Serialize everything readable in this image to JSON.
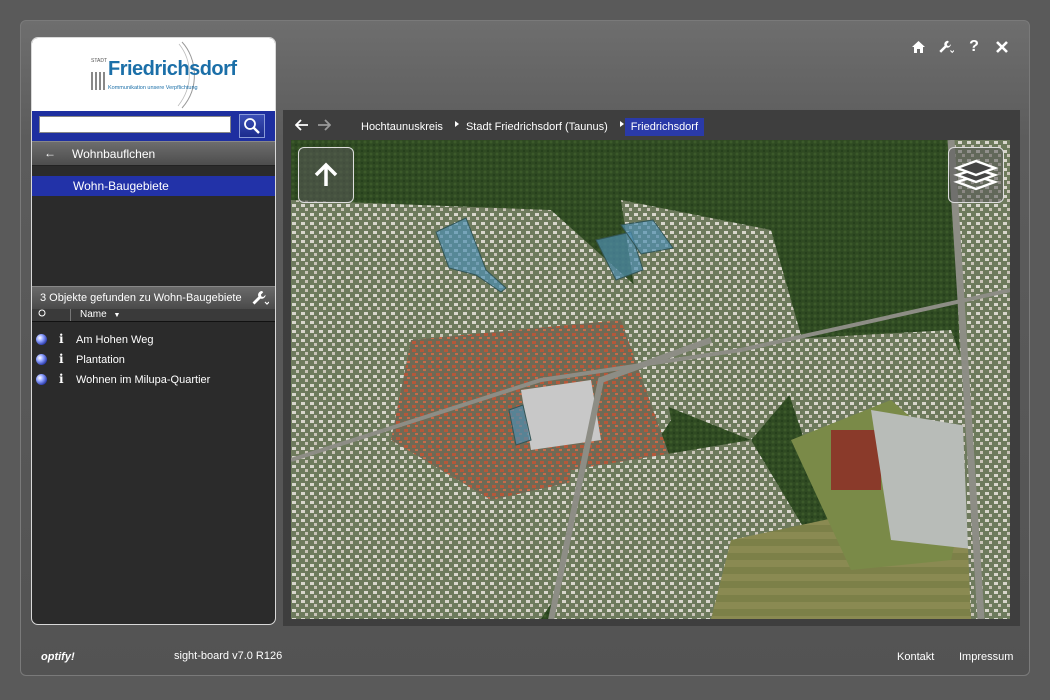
{
  "top_icons": [
    "home-icon",
    "wrench-icon",
    "help-icon",
    "close-icon"
  ],
  "top_icon_labels": {
    "help": "?"
  },
  "logo": {
    "small": "STADT",
    "name": "Friedrichsdorf",
    "tagline": "Kommunikation unsere Verpflichtung"
  },
  "search": {
    "value": "",
    "placeholder": ""
  },
  "category": {
    "back_label": "←",
    "title": "Wohnbauflchen"
  },
  "category_items": [
    {
      "label": "Wohn-Baugebiete"
    }
  ],
  "results_bar": {
    "label": "3 Objekte gefunden zu Wohn-Baugebiete"
  },
  "columns": {
    "name": "Name"
  },
  "results": [
    {
      "info": "i",
      "name": "Am Hohen Weg"
    },
    {
      "info": "i",
      "name": "Plantation"
    },
    {
      "info": "i",
      "name": "Wohnen im Milupa-Quartier"
    }
  ],
  "breadcrumbs": [
    {
      "label": "Hochtaunuskreis"
    },
    {
      "label": "Stadt Friedrichsdorf (Taunus)"
    },
    {
      "label": "Friedrichsdorf",
      "active": true
    }
  ],
  "footer": {
    "brand": "optify!",
    "version": "sight-board v7.0 R126",
    "kontakt": "Kontakt",
    "impressum": "Impressum"
  },
  "colors": {
    "accent": "#2232a8",
    "panel": "#2b2b2b",
    "background": "#5a5a5a"
  }
}
